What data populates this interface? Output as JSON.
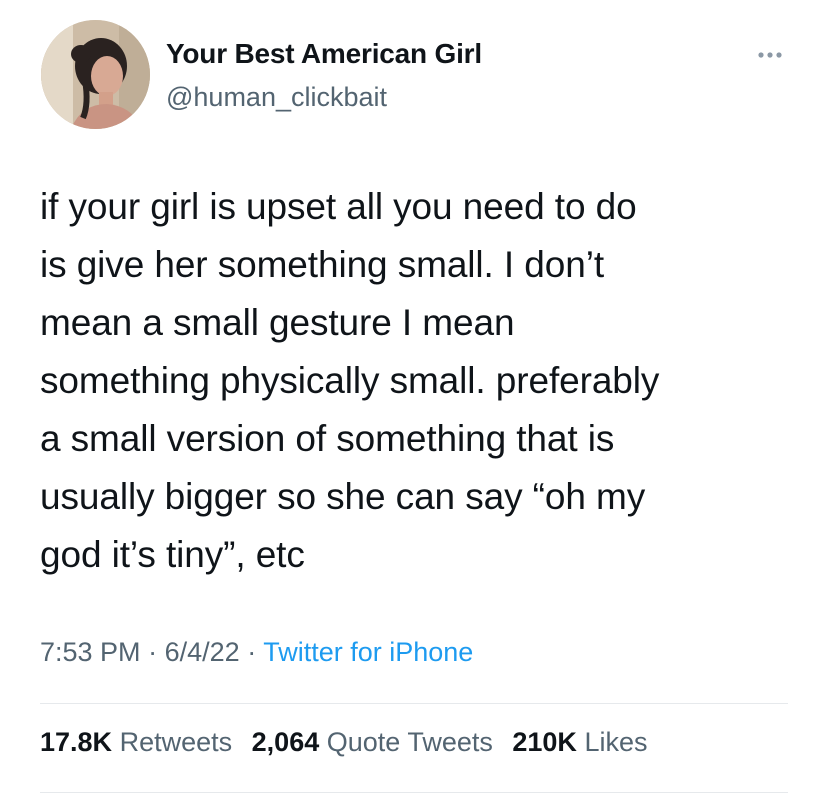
{
  "author": {
    "display_name": "Your Best American Girl",
    "handle": "@human_clickbait"
  },
  "tweet": {
    "text": "if your girl is upset all you need to do\nis give her something small. I don’t\nmean a small gesture I mean\nsomething physically small. preferably\na small version of something that is\nusually bigger so she can say “oh my\ngod it’s tiny”, etc",
    "time": "7:53 PM",
    "separator": "·",
    "date": "6/4/22",
    "source": "Twitter for iPhone"
  },
  "stats": {
    "retweets_count": "17.8K",
    "retweets_label": "Retweets",
    "quotes_count": "2,064",
    "quotes_label": "Quote Tweets",
    "likes_count": "210K",
    "likes_label": "Likes"
  },
  "icons": {
    "more": "more-options-icon",
    "avatar": "profile-photo"
  },
  "colors": {
    "text": "#0f1419",
    "secondary": "#536471",
    "link": "#1d9bf0",
    "divider": "#e6e9ec"
  }
}
